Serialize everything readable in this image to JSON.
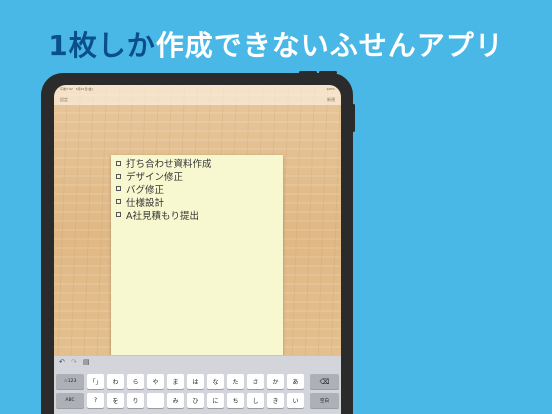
{
  "headline": {
    "accent": "1枚しか",
    "rest": "作成できないふせんアプリ"
  },
  "status_bar": {
    "left": "午後7:47　5月21日(金)",
    "right": "100%"
  },
  "nav": {
    "left_label": "設定",
    "right_label": "新規"
  },
  "sticky_note": {
    "color": "#f7f8cf",
    "tasks": [
      {
        "label": "打ち合わせ資料作成",
        "checked": false
      },
      {
        "label": "デザイン修正",
        "checked": false
      },
      {
        "label": "バグ修正",
        "checked": false
      },
      {
        "label": "仕様設計",
        "checked": false
      },
      {
        "label": "A社見積もり提出",
        "checked": false
      }
    ]
  },
  "keyboard_toolbar": {
    "undo_icon": "undo-icon",
    "redo_icon": "redo-icon",
    "paste_icon": "clipboard-icon"
  },
  "keyboard": {
    "row1": [
      "☆123",
      "「」",
      "わ",
      "ら",
      "や",
      "ま",
      "は",
      "な",
      "た",
      "さ",
      "か",
      "あ",
      "⌫"
    ],
    "row2": [
      "ABC",
      "?",
      "を",
      "り",
      "",
      "み",
      "ひ",
      "に",
      "ち",
      "し",
      "き",
      "い",
      "空白"
    ]
  },
  "colors": {
    "background": "#4ab8e6",
    "accent": "#0a4f8c"
  }
}
